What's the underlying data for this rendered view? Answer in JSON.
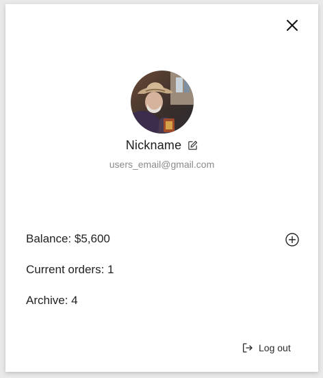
{
  "profile": {
    "nickname": "Nickname",
    "email": "users_email@gmail.com"
  },
  "stats": {
    "balance": "Balance: $5,600",
    "current_orders": "Current orders: 1",
    "archive": "Archive: 4"
  },
  "actions": {
    "logout_label": "Log out"
  },
  "icons": {
    "close": "close-icon",
    "edit": "edit-pencil-icon",
    "add": "plus-circle-icon",
    "logout": "logout-icon"
  },
  "colors": {
    "text": "#1c1c1c",
    "muted": "#8a8a8a",
    "panel": "#ffffff",
    "backdrop": "#e9e9e9"
  }
}
